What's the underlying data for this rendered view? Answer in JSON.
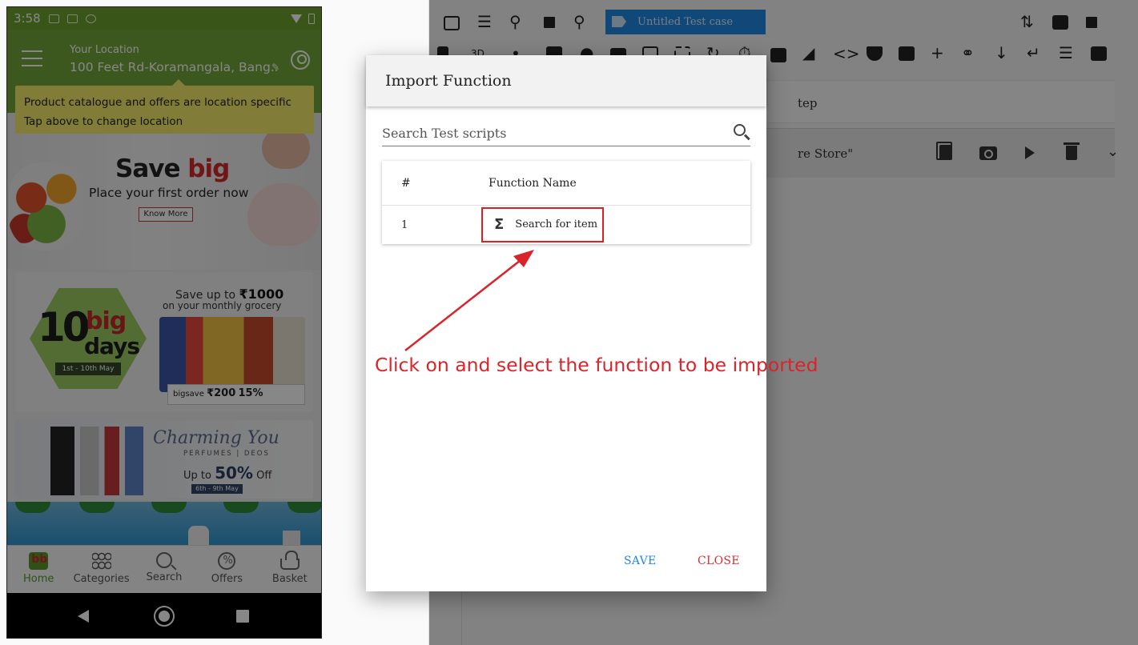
{
  "phone": {
    "status_time": "3:58",
    "location_label": "Your Location",
    "location_value": "100 Feet Rd-Koramangala, Bang...",
    "tooltip_line1": "Product catalogue and offers are location specific",
    "tooltip_line2": "Tap above to change location",
    "banner1": {
      "save": "Save",
      "big": "big",
      "subtitle": "Place your first order now",
      "button": "Know More"
    },
    "banner2": {
      "ten": "10",
      "big": "big",
      "days": "days",
      "dates": "1st - 10th May",
      "save_upto": "Save up to",
      "amount": "₹1000",
      "monthly": "on your monthly grocery",
      "bigsave": "bigsave",
      "cashback": "₹200",
      "discount": "15%"
    },
    "banner3": {
      "title": "Charming You",
      "subtitle": "PERFUMES | DEOS",
      "upto": "Up to",
      "percent": "50%",
      "off": "Off",
      "dates": "6th - 9th May"
    },
    "bottom_nav": [
      {
        "label": "Home",
        "icon": "home-icon"
      },
      {
        "label": "Categories",
        "icon": "grid-icon"
      },
      {
        "label": "Search",
        "icon": "search-icon"
      },
      {
        "label": "Offers",
        "icon": "offer-icon"
      },
      {
        "label": "Basket",
        "icon": "basket-icon"
      }
    ]
  },
  "editor": {
    "test_case_title": "Untitled Test case",
    "step_bar_text": "tep",
    "step_row_text": "re Store\""
  },
  "modal": {
    "title": "Import Function",
    "search_placeholder": "Search Test scripts",
    "columns": [
      "#",
      "Function Name"
    ],
    "rows": [
      {
        "num": "1",
        "name": "Search for item"
      }
    ],
    "save_label": "SAVE",
    "close_label": "CLOSE"
  },
  "annotation": {
    "text": "Click on and select the function to be imported",
    "color": "#d9242a"
  },
  "colors": {
    "primary": "#1e88e5",
    "danger": "#d32f2f",
    "phone_header": "#74a63a"
  }
}
